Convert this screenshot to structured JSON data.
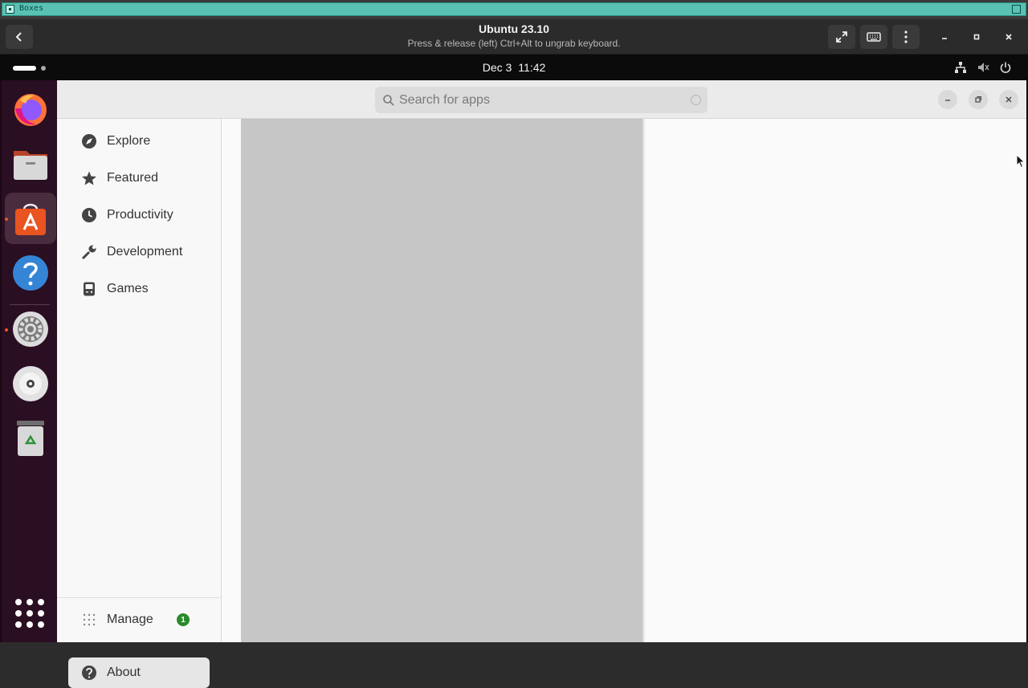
{
  "host": {
    "app_name": "Boxes"
  },
  "boxes_header": {
    "title": "Ubuntu 23.10",
    "subtitle": "Press & release (left) Ctrl+Alt to ungrab keyboard."
  },
  "guest_topbar": {
    "date": "Dec 3",
    "time": "11:42"
  },
  "dock": {
    "items": [
      {
        "name": "Firefox",
        "icon": "firefox-icon",
        "running": false
      },
      {
        "name": "Files",
        "icon": "files-icon",
        "running": false
      },
      {
        "name": "App Center",
        "icon": "app-center-icon",
        "running": true,
        "active": true
      },
      {
        "name": "Help",
        "icon": "help-icon",
        "running": false
      },
      {
        "name": "Settings",
        "icon": "settings-icon",
        "running": true
      },
      {
        "name": "Disc",
        "icon": "disc-icon",
        "running": false
      },
      {
        "name": "Trash",
        "icon": "trash-icon",
        "running": false
      }
    ],
    "show_apps_icon": "app-grid-icon"
  },
  "search": {
    "placeholder": "Search for apps",
    "value": ""
  },
  "sidebar": {
    "items": [
      {
        "label": "Explore",
        "icon": "compass-icon"
      },
      {
        "label": "Featured",
        "icon": "star-icon"
      },
      {
        "label": "Productivity",
        "icon": "clock-icon"
      },
      {
        "label": "Development",
        "icon": "wrench-icon"
      },
      {
        "label": "Games",
        "icon": "gamepad-icon"
      }
    ],
    "bottom_items": [
      {
        "label": "Manage",
        "icon": "grid-dots-icon",
        "badge": "1"
      },
      {
        "label": "About",
        "icon": "help-circle-icon",
        "selected": true
      }
    ]
  },
  "colors": {
    "ubuntu_orange": "#e95420",
    "dock_bg": "#2a0e22",
    "badge_green": "#2a8a2a",
    "boxes_accent": "#59c2b4"
  }
}
